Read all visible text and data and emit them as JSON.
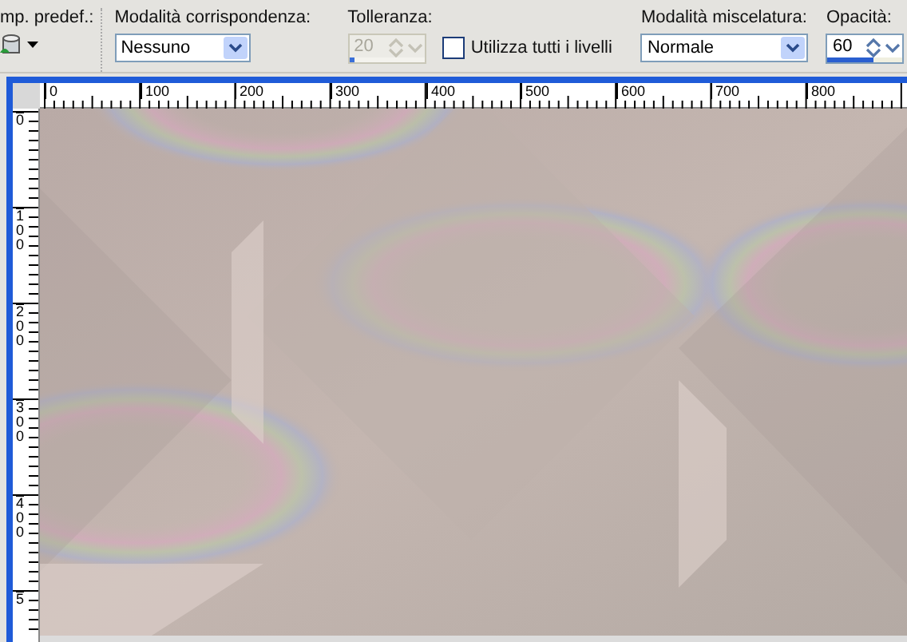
{
  "toolbar": {
    "preset": {
      "label": "mp. predef.:"
    },
    "match_mode": {
      "label": "Modalità corrispondenza:",
      "value": "Nessuno"
    },
    "tolerance": {
      "label": "Tolleranza:",
      "value": "20",
      "disabled": true,
      "level": 0.05
    },
    "all_layers": {
      "label": "Utilizza tutti i livelli",
      "checked": false
    },
    "blend_mode": {
      "label": "Modalità miscelatura:",
      "value": "Normale"
    },
    "opacity": {
      "label": "Opacità:",
      "value": "60",
      "disabled": false,
      "level": 0.6
    }
  },
  "rulers": {
    "horizontal": [
      "0",
      "100",
      "200",
      "300",
      "400",
      "500",
      "600",
      "700",
      "800"
    ],
    "vertical": [
      "0",
      "100",
      "200",
      "300",
      "400",
      "5"
    ]
  }
}
